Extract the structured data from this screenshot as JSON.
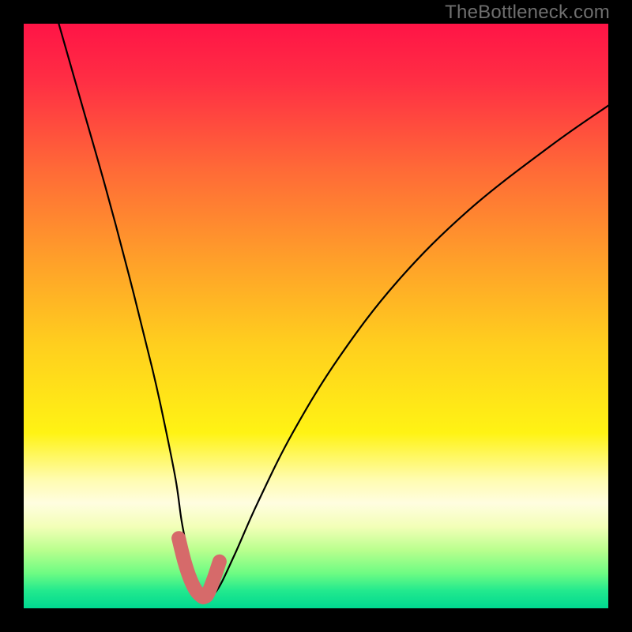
{
  "watermark": "TheBottleneck.com",
  "chart_data": {
    "type": "line",
    "title": "",
    "xlabel": "",
    "ylabel": "",
    "xlim": [
      0,
      100
    ],
    "ylim": [
      0,
      100
    ],
    "series": [
      {
        "name": "curve",
        "x": [
          6,
          10,
          14,
          18,
          22,
          24,
          26,
          27,
          28,
          29,
          30,
          31,
          33,
          36,
          40,
          46,
          54,
          64,
          76,
          90,
          100
        ],
        "values": [
          100,
          86,
          72,
          57,
          41,
          32,
          22,
          15,
          10,
          6,
          3,
          2,
          3,
          9,
          18,
          30,
          43,
          56,
          68,
          79,
          86
        ]
      }
    ],
    "highlight": {
      "name": "bottleneck-segment",
      "color": "#d66a6a",
      "x": [
        26.5,
        27.5,
        28.5,
        29.5,
        30.5,
        31.0,
        31.5,
        32.5,
        33.5
      ],
      "values": [
        12,
        8,
        5,
        3,
        2,
        2,
        2.5,
        5,
        8
      ]
    },
    "background_gradient": {
      "stops": [
        {
          "offset": 0.0,
          "color": "#ff1446"
        },
        {
          "offset": 0.1,
          "color": "#ff2f44"
        },
        {
          "offset": 0.25,
          "color": "#ff6a37"
        },
        {
          "offset": 0.4,
          "color": "#ff9e2a"
        },
        {
          "offset": 0.55,
          "color": "#ffcf1e"
        },
        {
          "offset": 0.7,
          "color": "#fff314"
        },
        {
          "offset": 0.78,
          "color": "#fffcb0"
        },
        {
          "offset": 0.82,
          "color": "#fffde0"
        },
        {
          "offset": 0.86,
          "color": "#f3ffb8"
        },
        {
          "offset": 0.9,
          "color": "#baff8e"
        },
        {
          "offset": 0.94,
          "color": "#6efc83"
        },
        {
          "offset": 0.97,
          "color": "#22e98e"
        },
        {
          "offset": 1.0,
          "color": "#00d890"
        }
      ]
    }
  }
}
